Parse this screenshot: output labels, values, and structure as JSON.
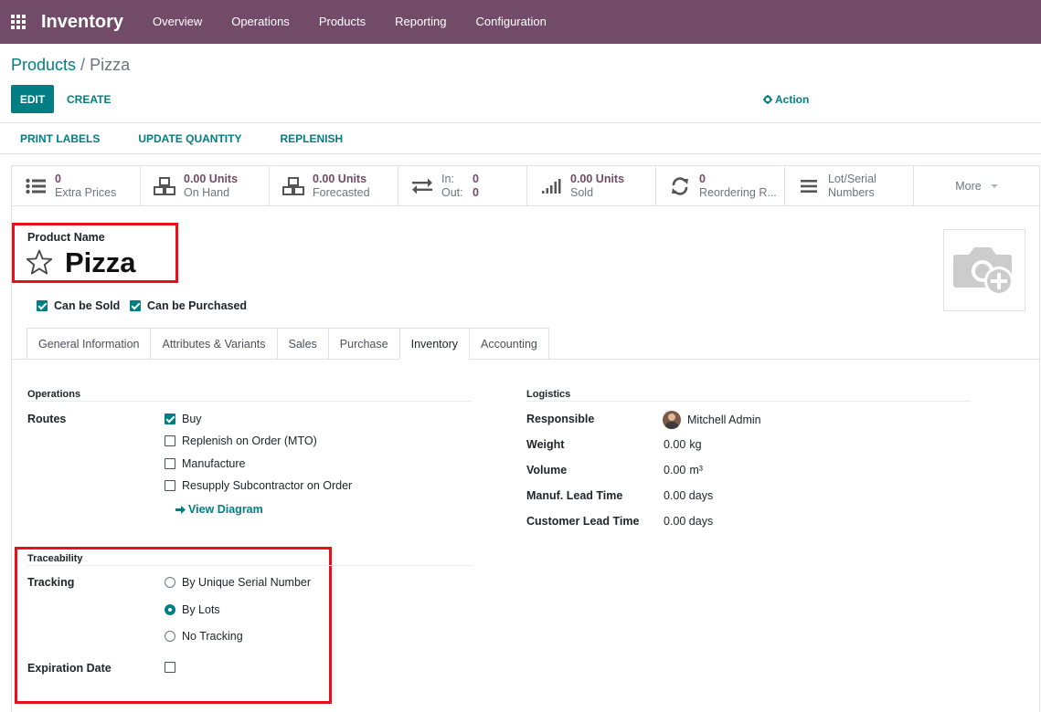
{
  "navbar": {
    "app_name": "Inventory",
    "menu": [
      "Overview",
      "Operations",
      "Products",
      "Reporting",
      "Configuration"
    ]
  },
  "breadcrumb": {
    "parent": "Products",
    "separator": " / ",
    "current": "Pizza"
  },
  "control": {
    "edit": "EDIT",
    "create": "CREATE",
    "action": "Action"
  },
  "statusbar": {
    "buttons": [
      "PRINT LABELS",
      "UPDATE QUANTITY",
      "REPLENISH"
    ]
  },
  "smart_buttons": {
    "extra_prices": {
      "value": "0",
      "label": "Extra Prices"
    },
    "on_hand": {
      "value": "0.00 Units",
      "label": "On Hand"
    },
    "forecasted": {
      "value": "0.00 Units",
      "label": "Forecasted"
    },
    "in_out": {
      "in_label": "In:",
      "in_value": "0",
      "out_label": "Out:",
      "out_value": "0"
    },
    "sold": {
      "value": "0.00 Units",
      "label": "Sold"
    },
    "reordering": {
      "value": "0",
      "label": "Reordering R..."
    },
    "lot_serial": {
      "line1": "Lot/Serial",
      "line2": "Numbers"
    },
    "more": "More"
  },
  "product": {
    "name_label": "Product Name",
    "name": "Pizza",
    "can_be_sold": {
      "label": "Can be Sold",
      "checked": true
    },
    "can_be_purchased": {
      "label": "Can be Purchased",
      "checked": true
    }
  },
  "tabs": [
    "General Information",
    "Attributes & Variants",
    "Sales",
    "Purchase",
    "Inventory",
    "Accounting"
  ],
  "active_tab": "Inventory",
  "operations": {
    "title": "Operations",
    "routes_label": "Routes",
    "routes": [
      {
        "label": "Buy",
        "checked": true
      },
      {
        "label": "Replenish on Order (MTO)",
        "checked": false
      },
      {
        "label": "Manufacture",
        "checked": false
      },
      {
        "label": "Resupply Subcontractor on Order",
        "checked": false
      }
    ],
    "view_diagram": "View Diagram"
  },
  "traceability": {
    "title": "Traceability",
    "tracking_label": "Tracking",
    "options": [
      {
        "label": "By Unique Serial Number",
        "selected": false
      },
      {
        "label": "By Lots",
        "selected": true
      },
      {
        "label": "No Tracking",
        "selected": false
      }
    ],
    "expiration_label": "Expiration Date",
    "expiration_checked": false
  },
  "logistics": {
    "title": "Logistics",
    "responsible_label": "Responsible",
    "responsible": "Mitchell Admin",
    "weight_label": "Weight",
    "weight": "0.00",
    "weight_unit": "kg",
    "volume_label": "Volume",
    "volume": "0.00",
    "volume_unit": "m³",
    "manuf_label": "Manuf. Lead Time",
    "manuf": "0.00 days",
    "customer_label": "Customer Lead Time",
    "customer": "0.00 days"
  },
  "colors": {
    "brand": "#714b67",
    "accent": "#017e84",
    "highlight": "#e8101b"
  }
}
